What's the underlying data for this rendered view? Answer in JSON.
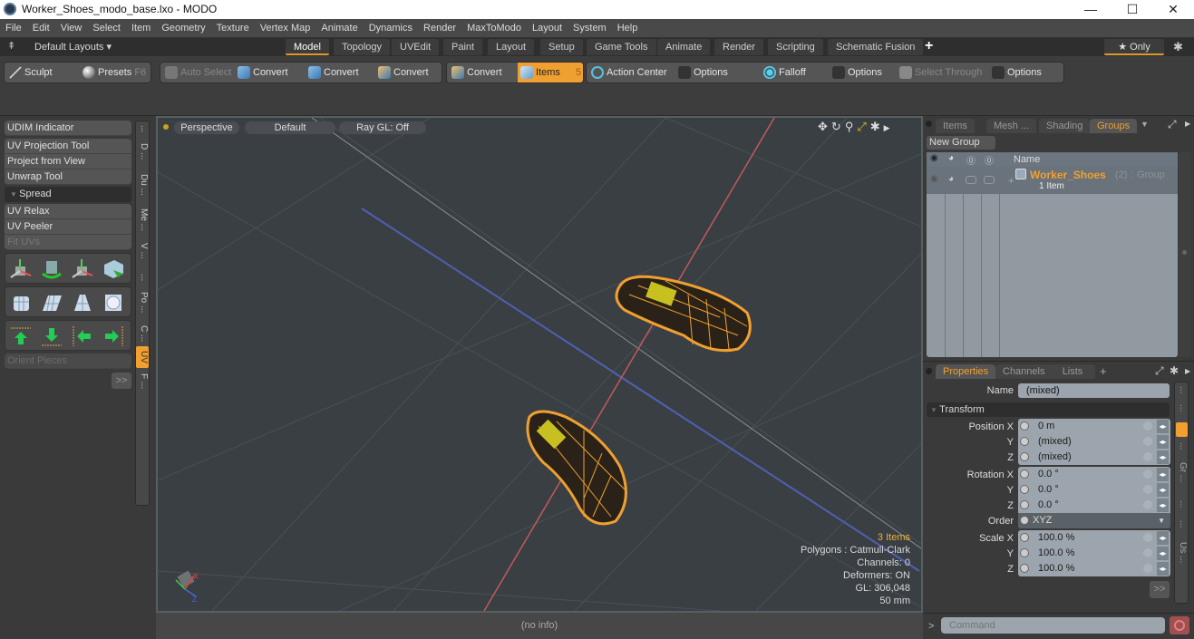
{
  "window": {
    "title": "Worker_Shoes_modo_base.lxo - MODO",
    "controls": {
      "minimize": "—",
      "maximize": "☐",
      "close": "✕"
    }
  },
  "menu": [
    "File",
    "Edit",
    "View",
    "Select",
    "Item",
    "Geometry",
    "Texture",
    "Vertex Map",
    "Animate",
    "Dynamics",
    "Render",
    "MaxToModo",
    "Layout",
    "System",
    "Help"
  ],
  "layouts": {
    "label": "Default Layouts ▾",
    "tabs": [
      "Model",
      "Topology",
      "UVEdit",
      "Paint",
      "Layout",
      "Setup",
      "Game Tools",
      "Animate",
      "Render",
      "Scripting",
      "Schematic Fusion"
    ],
    "active_tab": "Model",
    "add": "+",
    "only": "★ Only",
    "gear": "✱"
  },
  "toolbar": {
    "sculpt": "Sculpt",
    "presets": "Presets",
    "presets_key": "F6",
    "auto_select": "Auto Select",
    "convert1": "Convert",
    "convert2": "Convert",
    "convert3": "Convert",
    "convert4": "Convert",
    "items": "Items",
    "items_key": "5",
    "action_center": "Action Center",
    "options1": "Options",
    "falloff": "Falloff",
    "options2": "Options",
    "select_through": "Select Through",
    "options3": "Options"
  },
  "left_panel": {
    "udim": "UDIM Indicator",
    "tools": [
      "UV Projection Tool",
      "Project from View",
      "Unwrap Tool"
    ],
    "spread": "Spread",
    "tools2": [
      "UV Relax",
      "UV Peeler",
      "Fit UVs"
    ],
    "orient": "Orient Pieces",
    "more": ">>",
    "vtabs": [
      "...",
      "D ...",
      "Du ...",
      "Me ...",
      "V ...",
      "...",
      "Po ...",
      "C ...",
      "UV",
      "F ..."
    ],
    "active_vtab": "UV"
  },
  "viewport": {
    "view": "Perspective",
    "shading": "Default",
    "raygl": "Ray GL: Off",
    "info": {
      "items": "3 Items",
      "polygons": "Polygons : Catmull-Clark",
      "channels": "Channels: 0",
      "deformers": "Deformers: ON",
      "gl": "GL: 306,048",
      "scale": "50 mm"
    },
    "axis": {
      "x": "X",
      "y": "Y",
      "z": "Z"
    },
    "colors": {
      "wire": "#f0a030",
      "x_axis": "#c25a5a",
      "z_axis": "#5060b0"
    }
  },
  "status": "(no info)",
  "groups_panel": {
    "tabs": [
      "Items",
      "Mesh ...",
      "Shading",
      "Groups"
    ],
    "active_tab": "Groups",
    "new_group": "New Group",
    "col_name": "Name",
    "row": {
      "name": "Worker_Shoes",
      "count": "(2)",
      "type": ": Group",
      "sub": "1 Item"
    }
  },
  "properties_panel": {
    "tabs": [
      "Properties",
      "Channels",
      "Lists"
    ],
    "active_tab": "Properties",
    "add": "+",
    "name_label": "Name",
    "name_value": "(mixed)",
    "section": "Transform",
    "position": {
      "label": "Position X",
      "x": "0 m",
      "y": "(mixed)",
      "z": "(mixed)"
    },
    "rotation": {
      "label": "Rotation X",
      "x": "0.0 °",
      "y": "0.0 °",
      "z": "0.0 °"
    },
    "order": {
      "label": "Order",
      "value": "XYZ"
    },
    "scale": {
      "label": "Scale X",
      "x": "100.0 %",
      "y": "100.0 %",
      "z": "100.0 %"
    },
    "y_label": "Y",
    "z_label": "Z",
    "more": ">>",
    "side_tabs": [
      "...",
      "...",
      "",
      "...",
      "Gr ...",
      "...",
      "...",
      "Us ..."
    ]
  },
  "command": {
    "prompt": ">",
    "placeholder": "Command"
  }
}
